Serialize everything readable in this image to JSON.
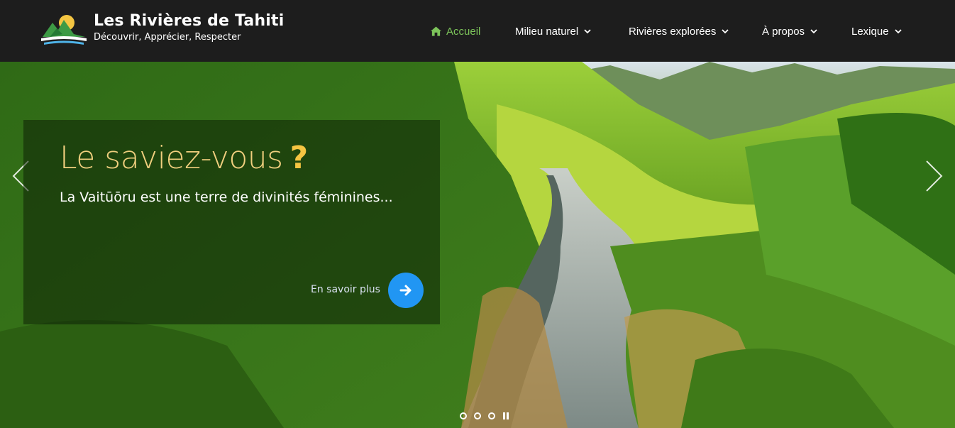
{
  "site": {
    "title": "Les Rivières de Tahiti",
    "tagline": "Découvrir, Apprécier, Respecter"
  },
  "nav": {
    "items": [
      {
        "label": "Accueil",
        "icon": "home-icon",
        "active": true,
        "dropdown": false
      },
      {
        "label": "Milieu naturel",
        "dropdown": true
      },
      {
        "label": "Rivières explorées",
        "dropdown": true
      },
      {
        "label": "À propos",
        "dropdown": true
      },
      {
        "label": "Lexique",
        "dropdown": true
      }
    ]
  },
  "slider": {
    "caption": {
      "title": "Le saviez-vous",
      "title_mark": "?",
      "text": "La Vaitūōru est une terre de divinités féminines...",
      "more_label": "En savoir plus"
    },
    "slide_count": 3,
    "active_slide": 1
  },
  "colors": {
    "header_bg": "#1d1d1d",
    "nav_active": "#7cc35a",
    "caption_title": "#f0cf7e",
    "question_mark": "#f5c542",
    "more_button": "#2196f3"
  }
}
